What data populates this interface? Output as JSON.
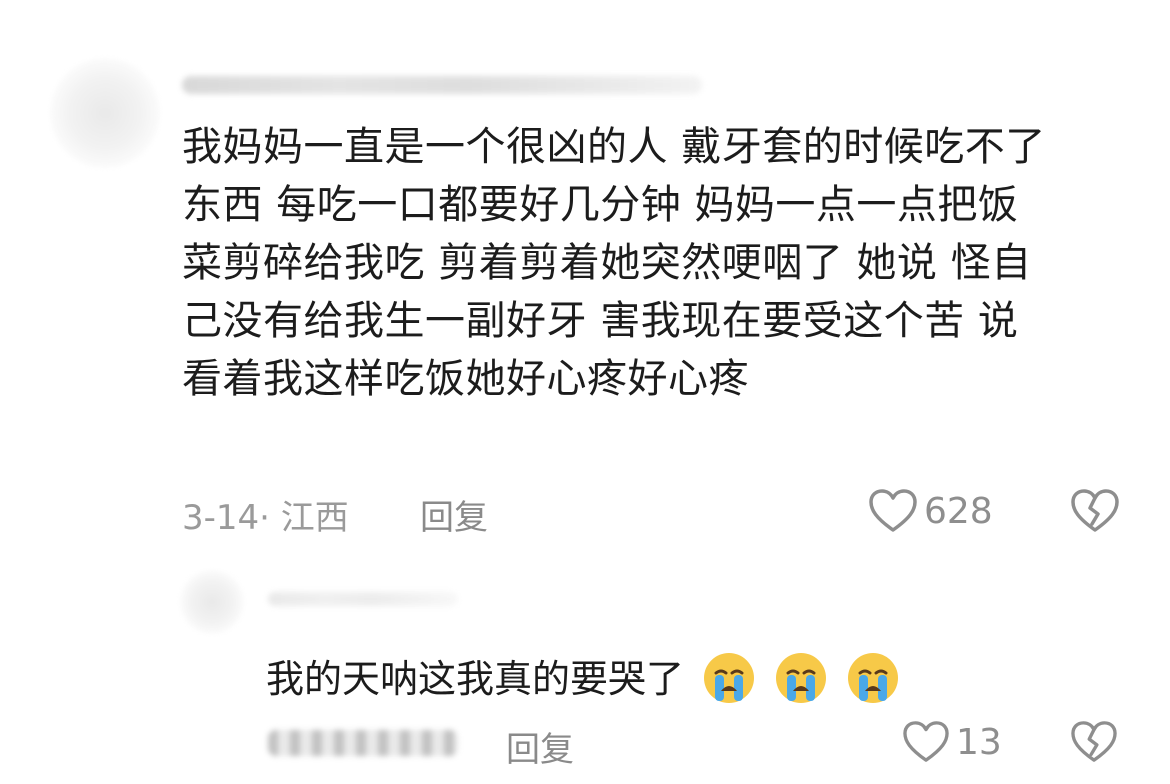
{
  "comment1": {
    "text_lines": [
      "我妈妈一直是一个很凶的人 戴牙套的时候吃不了",
      "东西 每吃一口都要好几分钟 妈妈一点一点把饭",
      "菜剪碎给我吃 剪着剪着她突然哽咽了 她说 怪自",
      "己没有给我生一副好牙 害我现在要受这个苦 说",
      "看着我这样吃饭她好心疼好心疼"
    ],
    "meta": "3-14· 江西",
    "reply_label": "回复",
    "like_count": "628"
  },
  "comment2": {
    "text": "我的天呐这我真的要哭了",
    "reply_label": "回复",
    "like_count": "13",
    "emoji": [
      "loudly-crying-face",
      "loudly-crying-face",
      "loudly-crying-face"
    ]
  },
  "colors": {
    "text": "#1c1c1c",
    "meta": "#9a9a9a",
    "icon": "#8e8e8e",
    "emoji_face": "#f7c948",
    "emoji_tear": "#4aa8e8"
  }
}
